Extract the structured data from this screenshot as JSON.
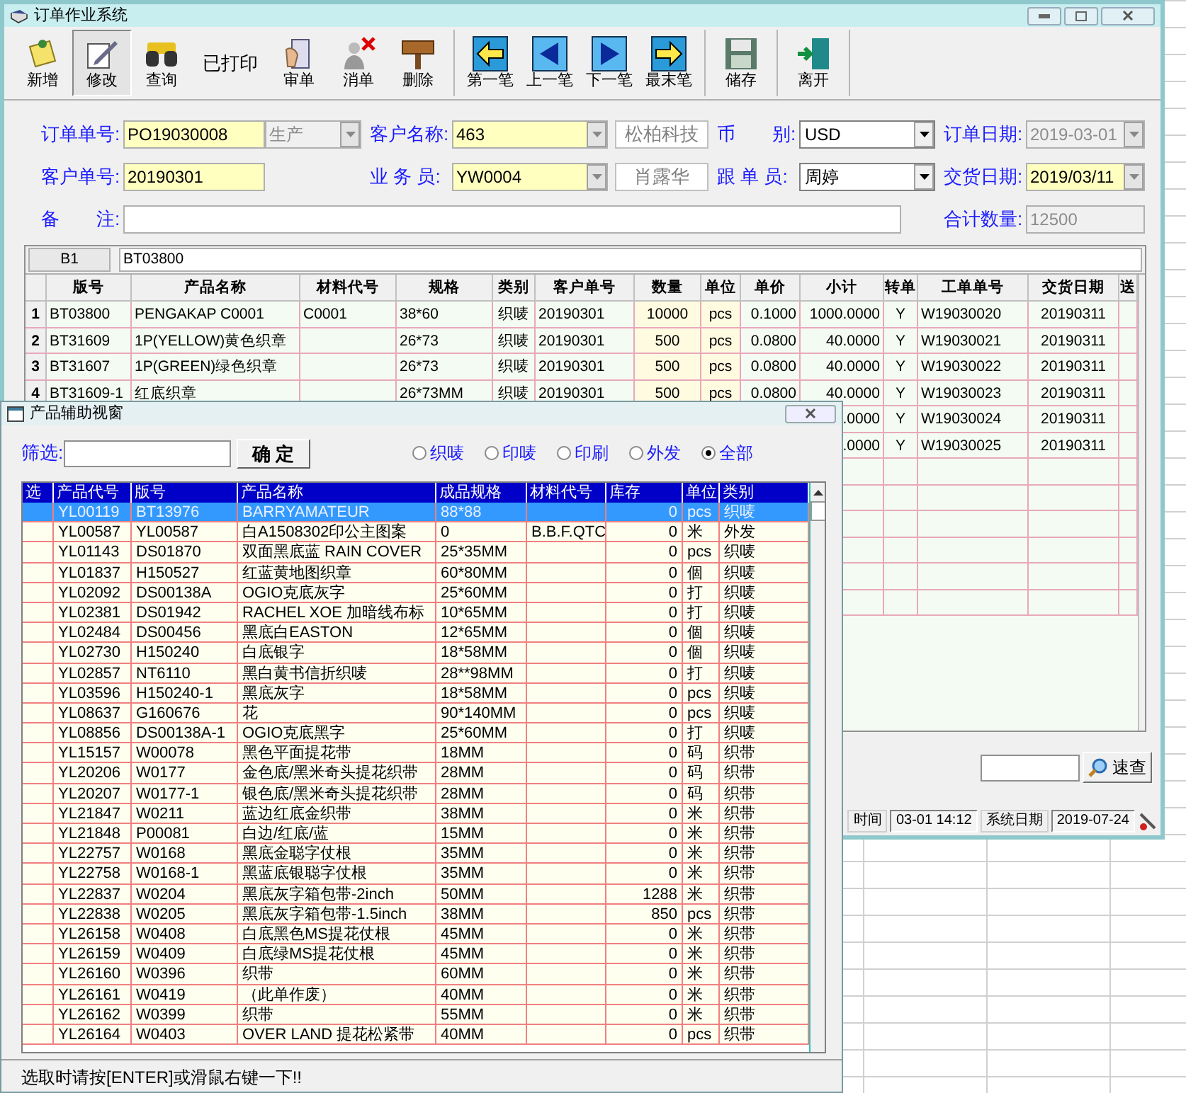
{
  "window": {
    "title": "订单作业系统"
  },
  "toolbar": {
    "groups": [
      {
        "items": [
          {
            "kind": "button",
            "label": "新增",
            "pressed": false
          },
          {
            "kind": "button",
            "label": "修改",
            "pressed": true
          },
          {
            "kind": "button",
            "label": "查询",
            "pressed": false
          },
          {
            "kind": "text",
            "label": "已打印"
          },
          {
            "kind": "button",
            "label": "审单",
            "pressed": false
          },
          {
            "kind": "button",
            "label": "消单",
            "pressed": false
          },
          {
            "kind": "button",
            "label": "删除",
            "pressed": false
          }
        ]
      },
      {
        "items": [
          {
            "kind": "button",
            "label": "第一笔",
            "pressed": false
          },
          {
            "kind": "button",
            "label": "上一笔",
            "pressed": false
          },
          {
            "kind": "button",
            "label": "下一笔",
            "pressed": false
          },
          {
            "kind": "button",
            "label": "最末笔",
            "pressed": false
          }
        ]
      },
      {
        "items": [
          {
            "kind": "button",
            "label": "储存",
            "pressed": false
          }
        ]
      },
      {
        "items": [
          {
            "kind": "button",
            "label": "离开",
            "pressed": false
          }
        ]
      }
    ]
  },
  "form": {
    "rows": [
      [
        {
          "label": "订单单号:",
          "parts": [
            {
              "kind": "text",
              "value": "PO19030008",
              "disabled": false
            },
            {
              "kind": "lookup",
              "value": "生产",
              "disabled": true
            }
          ]
        },
        {
          "label": "客户名称:",
          "parts": [
            {
              "kind": "lookup",
              "value": "463",
              "disabled": false
            },
            {
              "kind": "display",
              "value": "松柏科技"
            }
          ]
        },
        {
          "label": "币　　别:",
          "parts": [
            {
              "kind": "select",
              "value": "USD"
            }
          ]
        },
        {
          "label": "订单日期:",
          "parts": [
            {
              "kind": "lookup",
              "value": "2019-03-01",
              "disabled": true
            }
          ]
        }
      ],
      [
        {
          "label": "客户单号:",
          "parts": [
            {
              "kind": "text",
              "value": "20190301",
              "disabled": false
            }
          ]
        },
        {
          "label": "业 务 员:",
          "parts": [
            {
              "kind": "lookup",
              "value": "YW0004",
              "disabled": false
            },
            {
              "kind": "display",
              "value": "肖露华"
            }
          ]
        },
        {
          "label": "跟 单 员:",
          "parts": [
            {
              "kind": "select",
              "value": "周婷"
            }
          ]
        },
        {
          "label": "交货日期:",
          "parts": [
            {
              "kind": "lookup",
              "value": "2019/03/11",
              "disabled": false
            }
          ]
        }
      ],
      [
        {
          "label": "备　　注:",
          "parts": [
            {
              "kind": "text",
              "disabled": false
            }
          ]
        },
        "",
        "",
        {
          "label": "合计数量:",
          "parts": [
            {
              "kind": "text",
              "value": "12500",
              "disabled": true
            }
          ]
        }
      ]
    ]
  },
  "grid": {
    "cell_ref": "B1",
    "cell_value": "BT03800",
    "columns": [
      "版号",
      "产品名称",
      "材料代号",
      "规格",
      "类别",
      "客户单号",
      "数量",
      "单位",
      "单价",
      "小计",
      "转单",
      "工单单号",
      "交货日期",
      "送"
    ],
    "rows": [
      {
        "no": "1",
        "plate": "BT03800",
        "name": "PENGAKAP C0001",
        "material": "C0001",
        "spec": "38*60",
        "type": "织唛",
        "cust": "20190301",
        "qty": "10000",
        "unit": "pcs",
        "price": "0.1000",
        "subtotal": "1000.0000",
        "transfer": "Y",
        "work": "W19030020",
        "date": "20190311"
      },
      {
        "no": "2",
        "plate": "BT31609",
        "name": "1P(YELLOW)黄色织章",
        "spec": "26*73",
        "type": "织唛",
        "cust": "20190301",
        "qty": "500",
        "unit": "pcs",
        "price": "0.0800",
        "subtotal": "40.0000",
        "transfer": "Y",
        "work": "W19030021",
        "date": "20190311"
      },
      {
        "no": "3",
        "plate": "BT31607",
        "name": "1P(GREEN)绿色织章",
        "spec": "26*73",
        "type": "织唛",
        "cust": "20190301",
        "qty": "500",
        "unit": "pcs",
        "price": "0.0800",
        "subtotal": "40.0000",
        "transfer": "Y",
        "work": "W19030022",
        "date": "20190311"
      },
      {
        "no": "4",
        "plate": "BT31609-1",
        "name": "红底织章",
        "spec": "26*73MM",
        "type": "织唛",
        "cust": "20190301",
        "qty": "500",
        "unit": "pcs",
        "price": "0.0800",
        "subtotal": "40.0000",
        "transfer": "Y",
        "work": "W19030023",
        "date": "20190311"
      },
      {
        "subtotal": ".0000",
        "transfer": "Y",
        "work": "W19030024",
        "date": "20190311"
      },
      {
        "subtotal": ".0000",
        "transfer": "Y",
        "work": "W19030025",
        "date": "20190311"
      }
    ]
  },
  "search": {
    "button": "速查"
  },
  "status_bar": [
    {
      "kind": "label",
      "text": "时间"
    },
    {
      "kind": "value",
      "text": "03-01 14:12"
    },
    {
      "kind": "label",
      "text": "系统日期"
    },
    {
      "kind": "value",
      "text": "2019-07-24"
    }
  ],
  "popup": {
    "title": "产品辅助视窗",
    "filter_label": "筛选:",
    "confirm": "确 定",
    "options": [
      {
        "label": "织唛",
        "selected": false
      },
      {
        "label": "印唛",
        "selected": false
      },
      {
        "label": "印刷",
        "selected": false
      },
      {
        "label": "外发",
        "selected": false
      },
      {
        "label": "全部",
        "selected": true
      }
    ],
    "columns": [
      "选",
      "产品代号",
      "版号",
      "产品名称",
      "成品规格",
      "材料代号",
      "库存",
      "单位",
      "类别"
    ],
    "rows": [
      {
        "selected": true,
        "code": "YL00119",
        "plate": "BT13976",
        "name": "BARRYAMATEUR",
        "spec": "88*88",
        "stock": "0",
        "unit": "pcs",
        "type": "织唛"
      },
      {
        "selected": false,
        "code": "YL00587",
        "plate": "YL00587",
        "name": "白A1508302印公主图案",
        "spec": "0",
        "material": "B.B.F.QTC",
        "stock": "0",
        "unit": "米",
        "type": "外发"
      },
      {
        "selected": false,
        "code": "YL01143",
        "plate": "DS01870",
        "name": "双面黑底蓝 RAIN COVER",
        "spec": "25*35MM",
        "stock": "0",
        "unit": "pcs",
        "type": "织唛"
      },
      {
        "selected": false,
        "code": "YL01837",
        "plate": "H150527",
        "name": "红蓝黄地图织章",
        "spec": "60*80MM",
        "stock": "0",
        "unit": "個",
        "type": "织唛"
      },
      {
        "selected": false,
        "code": "YL02092",
        "plate": "DS00138A",
        "name": "OGIO克底灰字",
        "spec": "25*60MM",
        "stock": "0",
        "unit": "打",
        "type": "织唛"
      },
      {
        "selected": false,
        "code": "YL02381",
        "plate": "DS01942",
        "name": "RACHEL XOE 加暗线布标",
        "spec": "10*65MM",
        "stock": "0",
        "unit": "打",
        "type": "织唛"
      },
      {
        "selected": false,
        "code": "YL02484",
        "plate": "DS00456",
        "name": "黑底白EASTON",
        "spec": "12*65MM",
        "stock": "0",
        "unit": "個",
        "type": "织唛"
      },
      {
        "selected": false,
        "code": "YL02730",
        "plate": "H150240",
        "name": "白底银字",
        "spec": "18*58MM",
        "stock": "0",
        "unit": "個",
        "type": "织唛"
      },
      {
        "selected": false,
        "code": "YL02857",
        "plate": "NT6110",
        "name": "黑白黄书信折织唛",
        "spec": "28**98MM",
        "stock": "0",
        "unit": "打",
        "type": "织唛"
      },
      {
        "selected": false,
        "code": "YL03596",
        "plate": "H150240-1",
        "name": "黑底灰字",
        "spec": "18*58MM",
        "stock": "0",
        "unit": "pcs",
        "type": "织唛"
      },
      {
        "selected": false,
        "code": "YL08637",
        "plate": "G160676",
        "name": "花",
        "spec": "90*140MM",
        "stock": "0",
        "unit": "pcs",
        "type": "织唛"
      },
      {
        "selected": false,
        "code": "YL08856",
        "plate": "DS00138A-1",
        "name": "OGIO克底黑字",
        "spec": "25*60MM",
        "stock": "0",
        "unit": "打",
        "type": "织唛"
      },
      {
        "selected": false,
        "code": "YL15157",
        "plate": "W00078",
        "name": "黑色平面提花带",
        "spec": "18MM",
        "stock": "0",
        "unit": "码",
        "type": "织带"
      },
      {
        "selected": false,
        "code": "YL20206",
        "plate": "W0177",
        "name": "金色底/黑米奇头提花织带",
        "spec": "28MM",
        "stock": "0",
        "unit": "码",
        "type": "织带"
      },
      {
        "selected": false,
        "code": "YL20207",
        "plate": "W0177-1",
        "name": "银色底/黑米奇头提花织带",
        "spec": "28MM",
        "stock": "0",
        "unit": "码",
        "type": "织带"
      },
      {
        "selected": false,
        "code": "YL21847",
        "plate": "W0211",
        "name": "蓝边红底金织带",
        "spec": "38MM",
        "stock": "0",
        "unit": "米",
        "type": "织带"
      },
      {
        "selected": false,
        "code": "YL21848",
        "plate": "P00081",
        "name": "白边/红底/蓝",
        "spec": "15MM",
        "stock": "0",
        "unit": "米",
        "type": "织带"
      },
      {
        "selected": false,
        "code": "YL22757",
        "plate": "W0168",
        "name": "黑底金聪字仗根",
        "spec": "35MM",
        "stock": "0",
        "unit": "米",
        "type": "织带"
      },
      {
        "selected": false,
        "code": "YL22758",
        "plate": "W0168-1",
        "name": "黑蓝底银聪字仗根",
        "spec": "35MM",
        "stock": "0",
        "unit": "米",
        "type": "织带"
      },
      {
        "selected": false,
        "code": "YL22837",
        "plate": "W0204",
        "name": "黑底灰字箱包带-2inch",
        "spec": "50MM",
        "stock": "1288",
        "unit": "米",
        "type": "织带"
      },
      {
        "selected": false,
        "code": "YL22838",
        "plate": "W0205",
        "name": "黑底灰字箱包带-1.5inch",
        "spec": "38MM",
        "stock": "850",
        "unit": "pcs",
        "type": "织带"
      },
      {
        "selected": false,
        "code": "YL26158",
        "plate": "W0408",
        "name": "白底黑色MS提花仗根",
        "spec": "45MM",
        "stock": "0",
        "unit": "米",
        "type": "织带"
      },
      {
        "selected": false,
        "code": "YL26159",
        "plate": "W0409",
        "name": "白底绿MS提花仗根",
        "spec": "45MM",
        "stock": "0",
        "unit": "米",
        "type": "织带"
      },
      {
        "selected": false,
        "code": "YL26160",
        "plate": "W0396",
        "name": "织带",
        "spec": "60MM",
        "stock": "0",
        "unit": "米",
        "type": "织带"
      },
      {
        "selected": false,
        "code": "YL26161",
        "plate": "W0419",
        "name": "（此单作废）",
        "spec": "40MM",
        "stock": "0",
        "unit": "米",
        "type": "织带"
      },
      {
        "selected": false,
        "code": "YL26162",
        "plate": "W0399",
        "name": "织带",
        "spec": "55MM",
        "stock": "0",
        "unit": "米",
        "type": "织带"
      },
      {
        "selected": false,
        "code": "YL26164",
        "plate": "W0403",
        "name": "OVER LAND 提花松紧带",
        "spec": "40MM",
        "stock": "0",
        "unit": "pcs",
        "type": "织带"
      }
    ],
    "hint": "选取时请按[ENTER]或滑鼠右键一下!!"
  }
}
